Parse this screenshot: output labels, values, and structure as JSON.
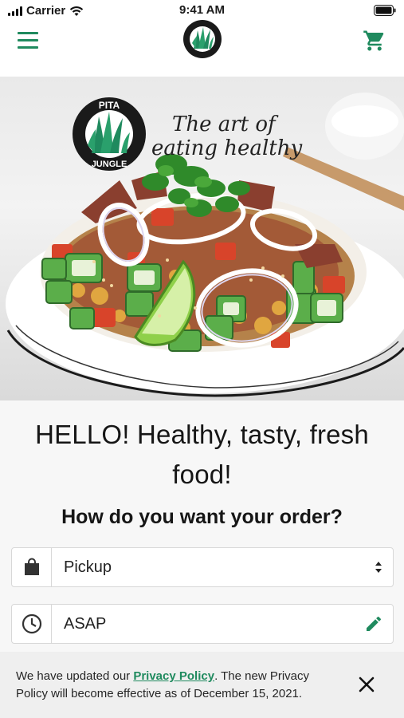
{
  "status_bar": {
    "carrier": "Carrier",
    "time": "9:41 AM",
    "icons": [
      "signal-icon",
      "wifi-icon",
      "battery-icon"
    ]
  },
  "header": {
    "menu_icon": "hamburger-menu-icon",
    "logo_text": "PITA JUNGLE",
    "cart_icon": "shopping-cart-icon",
    "accent_color": "#1f8a5e"
  },
  "hero": {
    "logo_text_top": "PITA",
    "logo_text_bottom": "JUNGLE",
    "tagline_line1": "The art of",
    "tagline_line2": "eating healthy"
  },
  "main": {
    "headline": "HELLO! Healthy, tasty, fresh food!",
    "order_question": "How do you want your order?",
    "order_type": {
      "icon": "shopping-bag-icon",
      "value": "Pickup",
      "trail_icon": "select-arrows-icon"
    },
    "order_time": {
      "icon": "clock-icon",
      "value": "ASAP",
      "trail_icon": "edit-pencil-icon"
    }
  },
  "banner": {
    "text_before": "We have updated our ",
    "link_text": "Privacy Policy",
    "text_after": ". The new Privacy Policy will become effective as of December 15, 2021.",
    "close_icon": "close-icon"
  }
}
